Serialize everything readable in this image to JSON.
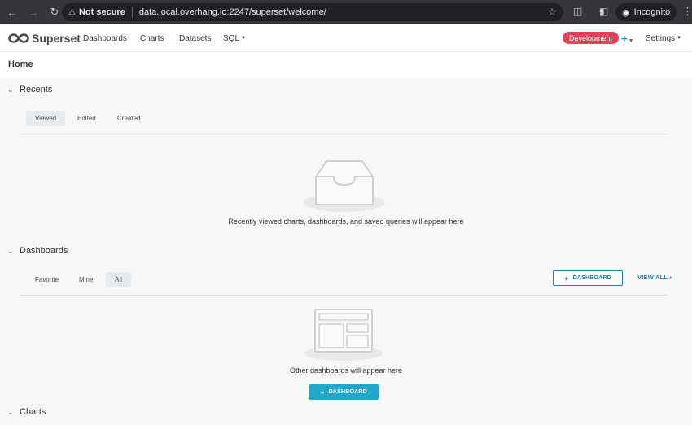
{
  "browser": {
    "not_secure": "Not secure",
    "url": "data.local.overhang.io:2247/superset/welcome/",
    "incognito": "Incognito"
  },
  "header": {
    "brand": "Superset",
    "nav": [
      "Dashboards",
      "Charts",
      "Datasets",
      "SQL"
    ],
    "environment_badge": "Development",
    "settings": "Settings"
  },
  "page": {
    "title": "Home"
  },
  "recents": {
    "title": "Recents",
    "tabs": [
      "Viewed",
      "Edited",
      "Created"
    ],
    "active_tab": "Viewed",
    "empty_message": "Recently viewed charts, dashboards, and saved queries will appear here"
  },
  "dashboards": {
    "title": "Dashboards",
    "tabs": [
      "Favorite",
      "Mine",
      "All"
    ],
    "active_tab": "All",
    "add_button": "DASHBOARD",
    "view_all": "VIEW ALL »",
    "empty_message": "Other dashboards will appear here",
    "empty_button": "DASHBOARD"
  },
  "charts": {
    "title": "Charts"
  },
  "colors": {
    "accent": "#20a7c9",
    "accent_dark": "#1a85a0",
    "badge": "#e04355"
  }
}
